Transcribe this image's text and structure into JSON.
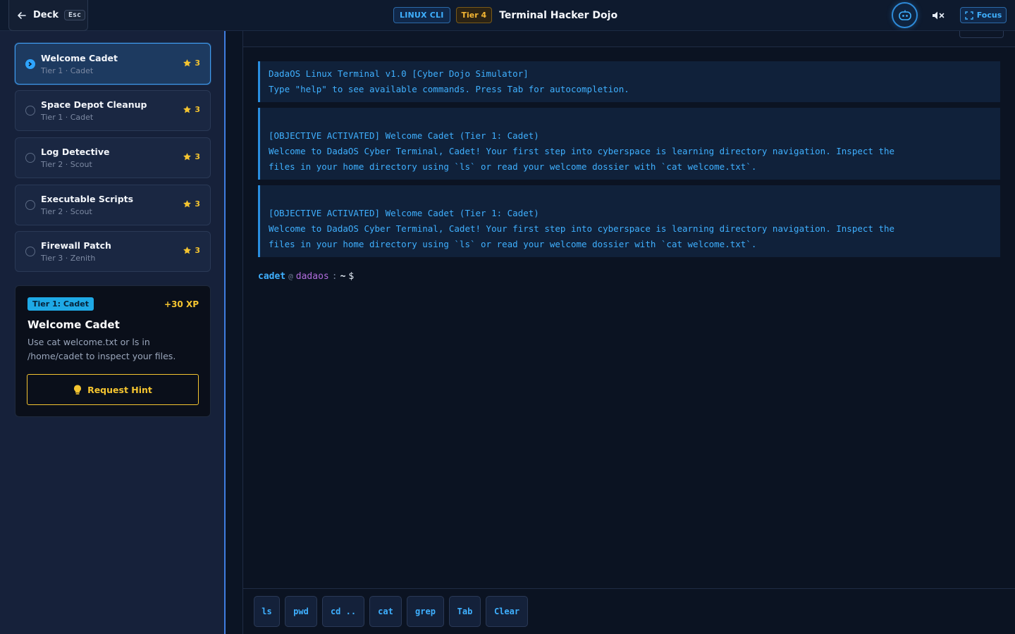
{
  "header": {
    "back_label": "Deck",
    "back_key": "Esc",
    "badge_category": "LINUX CLI",
    "badge_tier": "Tier 4",
    "title": "Terminal Hacker Dojo",
    "focus_label": "Focus",
    "avatar_icon": "robot-icon",
    "mute_icon": "mute-icon"
  },
  "sidebar": {
    "levels": [
      {
        "name": "Welcome Cadet",
        "subtitle": "Tier 1 · Cadet",
        "stars": "3",
        "active": true
      },
      {
        "name": "Space Depot Cleanup",
        "subtitle": "Tier 1 · Cadet",
        "stars": "3",
        "active": false
      },
      {
        "name": "Log Detective",
        "subtitle": "Tier 2 · Scout",
        "stars": "3",
        "active": false
      },
      {
        "name": "Executable Scripts",
        "subtitle": "Tier 2 · Scout",
        "stars": "3",
        "active": false
      },
      {
        "name": "Firewall Patch",
        "subtitle": "Tier 3 · Zenith",
        "stars": "3",
        "active": false
      }
    ],
    "mission": {
      "tier_label": "Tier 1: Cadet",
      "xp": "+30 XP",
      "title": "Welcome Cadet",
      "description": "Use cat welcome.txt or ls in /home/cadet to inspect your files.",
      "hint_label": "Request Hint"
    }
  },
  "terminal": {
    "output": [
      "DadaOS Linux Terminal v1.0 [Cyber Dojo Simulator]\nType \"help\" to see available commands. Press Tab for autocompletion.",
      "\n[OBJECTIVE ACTIVATED] Welcome Cadet (Tier 1: Cadet)\nWelcome to DadaOS Cyber Terminal, Cadet! Your first step into cyberspace is learning directory navigation. Inspect the\nfiles in your home directory using `ls` or read your welcome dossier with `cat welcome.txt`.",
      "\n[OBJECTIVE ACTIVATED] Welcome Cadet (Tier 1: Cadet)\nWelcome to DadaOS Cyber Terminal, Cadet! Your first step into cyberspace is learning directory navigation. Inspect the\nfiles in your home directory using `ls` or read your welcome dossier with `cat welcome.txt`."
    ],
    "prompt": {
      "user": "cadet",
      "at": "@",
      "host": "dadaos",
      "sep": ":",
      "path": "~",
      "symbol": "$"
    },
    "quick_commands": [
      "ls",
      "pwd",
      "cd ..",
      "cat",
      "grep",
      "Tab",
      "Clear"
    ]
  }
}
